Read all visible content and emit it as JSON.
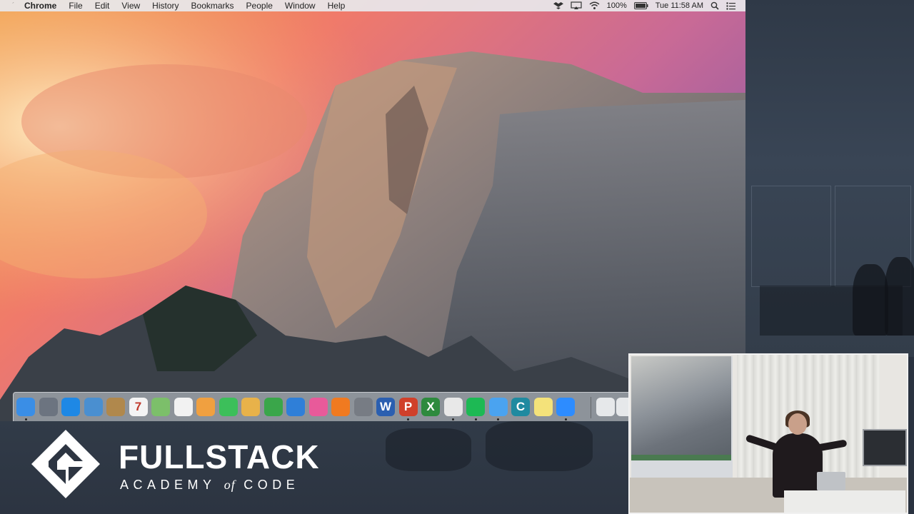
{
  "menubar": {
    "app_name": "Chrome",
    "items": [
      "File",
      "Edit",
      "View",
      "History",
      "Bookmarks",
      "People",
      "Window",
      "Help"
    ],
    "battery": "100%",
    "clock": "Tue 11:58 AM"
  },
  "dock": {
    "apps": [
      {
        "name": "finder",
        "glyph": "",
        "color": "#3a8ee6",
        "running": true
      },
      {
        "name": "launchpad",
        "glyph": "",
        "color": "#6c7480",
        "running": false
      },
      {
        "name": "safari",
        "glyph": "",
        "color": "#1e88e5",
        "running": false
      },
      {
        "name": "preview",
        "glyph": "",
        "color": "#4a8fd0",
        "running": false
      },
      {
        "name": "contacts",
        "glyph": "",
        "color": "#b0884c",
        "running": false
      },
      {
        "name": "calendar",
        "glyph": "7",
        "color": "#f4f4f4",
        "running": false
      },
      {
        "name": "maps",
        "glyph": "",
        "color": "#7cbf6a",
        "running": false
      },
      {
        "name": "reminders",
        "glyph": "",
        "color": "#f2f2f2",
        "running": false
      },
      {
        "name": "photos",
        "glyph": "",
        "color": "#f0a040",
        "running": false
      },
      {
        "name": "facetime",
        "glyph": "",
        "color": "#3cbf5a",
        "running": false
      },
      {
        "name": "pages",
        "glyph": "",
        "color": "#e8b24a",
        "running": false
      },
      {
        "name": "numbers",
        "glyph": "",
        "color": "#3aa64a",
        "running": false
      },
      {
        "name": "keynote",
        "glyph": "",
        "color": "#2f7fd8",
        "running": false
      },
      {
        "name": "itunes",
        "glyph": "",
        "color": "#e85a9a",
        "running": false
      },
      {
        "name": "ibooks",
        "glyph": "",
        "color": "#f07a20",
        "running": false
      },
      {
        "name": "system-preferences",
        "glyph": "",
        "color": "#777c84",
        "running": false
      },
      {
        "name": "word",
        "glyph": "W",
        "color": "#2b5fb0",
        "running": false
      },
      {
        "name": "powerpoint",
        "glyph": "P",
        "color": "#d0402a",
        "running": true
      },
      {
        "name": "excel",
        "glyph": "X",
        "color": "#2e8a3e",
        "running": false
      },
      {
        "name": "chrome",
        "glyph": "",
        "color": "#e8e8e8",
        "running": true
      },
      {
        "name": "spotify",
        "glyph": "",
        "color": "#1db954",
        "running": true
      },
      {
        "name": "messages",
        "glyph": "",
        "color": "#4aa3f0",
        "running": true
      },
      {
        "name": "c-app",
        "glyph": "C",
        "color": "#1f8aa0",
        "running": false
      },
      {
        "name": "stickies",
        "glyph": "",
        "color": "#f4e27a",
        "running": false
      },
      {
        "name": "zoom",
        "glyph": "",
        "color": "#2d8cff",
        "running": true
      }
    ],
    "trailing": [
      {
        "name": "documents-stack"
      },
      {
        "name": "downloads-stack"
      }
    ]
  },
  "brand": {
    "title": "FULLSTACK",
    "subtitle_before": "ACADEMY",
    "subtitle_of": "of",
    "subtitle_after": "CODE"
  }
}
